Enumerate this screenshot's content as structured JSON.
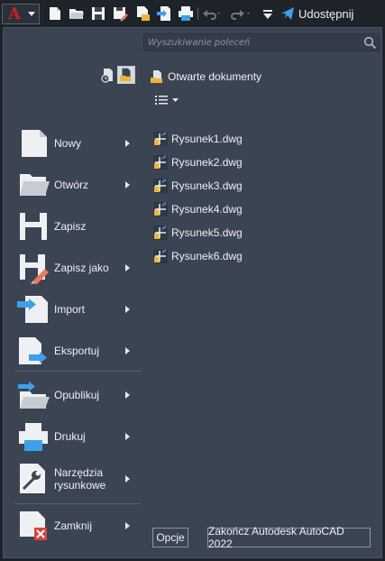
{
  "app": {
    "logo_letter": "A",
    "share_label": "Udostępnij",
    "colors": {
      "panel": "#3b4453",
      "accent_red": "#d11d1d",
      "share_blue": "#3ea0e8",
      "dwg_yellow": "#f0b43a"
    }
  },
  "toolbar": {
    "icons": [
      "new-icon",
      "open-icon",
      "save-icon",
      "save-as-icon",
      "open-from-web-icon",
      "save-to-web-icon",
      "plot-icon",
      "undo-icon",
      "redo-icon",
      "customize-icon",
      "share-icon"
    ]
  },
  "search": {
    "placeholder": "Wyszukiwanie poleceń"
  },
  "menu": {
    "items": [
      {
        "label": "Nowy",
        "icon": "new-document-icon",
        "has_submenu": true
      },
      {
        "label": "Otwórz",
        "icon": "open-folder-icon",
        "has_submenu": true
      },
      {
        "label": "Zapisz",
        "icon": "save-floppy-icon",
        "has_submenu": false
      },
      {
        "label": "Zapisz jako",
        "icon": "save-as-icon",
        "has_submenu": true
      },
      {
        "label": "Import",
        "icon": "import-icon",
        "has_submenu": true
      },
      {
        "label": "Eksportuj",
        "icon": "export-icon",
        "has_submenu": true
      },
      {
        "label": "Opublikuj",
        "icon": "publish-icon",
        "has_submenu": true
      },
      {
        "label": "Drukuj",
        "icon": "printer-icon",
        "has_submenu": true
      },
      {
        "label": "Narzędzia rysunkowe",
        "icon": "drawing-utilities-icon",
        "has_submenu": true
      },
      {
        "label": "Zamknij",
        "icon": "close-document-icon",
        "has_submenu": true
      }
    ]
  },
  "open_documents": {
    "title": "Otwarte dokumenty",
    "files": [
      "Rysunek1.dwg",
      "Rysunek2.dwg",
      "Rysunek3.dwg",
      "Rysunek4.dwg",
      "Rysunek5.dwg",
      "Rysunek6.dwg"
    ]
  },
  "footer": {
    "options_label": "Opcje",
    "exit_label": "Zakończ Autodesk AutoCAD 2022"
  }
}
